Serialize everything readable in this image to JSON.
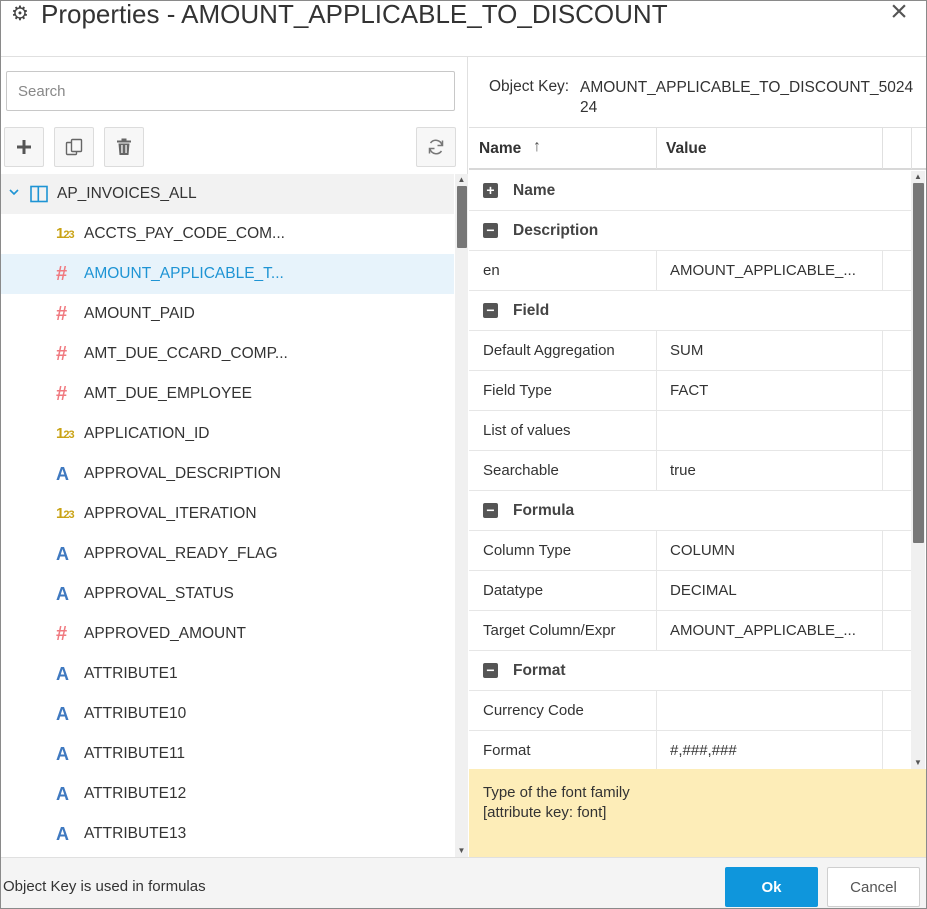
{
  "dialog": {
    "title": "Properties - AMOUNT_APPLICABLE_TO_DISCOUNT",
    "title_icon": "gear-icon",
    "close_label": "×"
  },
  "left": {
    "search_placeholder": "Search",
    "toolbar": {
      "add_icon": "plus-icon",
      "copy_icon": "copy-icon",
      "delete_icon": "trash-icon",
      "refresh_icon": "refresh-icon"
    },
    "root": {
      "label": "AP_INVOICES_ALL",
      "icon": "table-icon"
    },
    "items": [
      {
        "label": "ACCTS_PAY_CODE_COM...",
        "type": "number"
      },
      {
        "label": "AMOUNT_APPLICABLE_T...",
        "type": "decimal",
        "selected": true
      },
      {
        "label": "AMOUNT_PAID",
        "type": "decimal"
      },
      {
        "label": "AMT_DUE_CCARD_COMP...",
        "type": "decimal"
      },
      {
        "label": "AMT_DUE_EMPLOYEE",
        "type": "decimal"
      },
      {
        "label": "APPLICATION_ID",
        "type": "number"
      },
      {
        "label": "APPROVAL_DESCRIPTION",
        "type": "text"
      },
      {
        "label": "APPROVAL_ITERATION",
        "type": "number"
      },
      {
        "label": "APPROVAL_READY_FLAG",
        "type": "text"
      },
      {
        "label": "APPROVAL_STATUS",
        "type": "text"
      },
      {
        "label": "APPROVED_AMOUNT",
        "type": "decimal"
      },
      {
        "label": "ATTRIBUTE1",
        "type": "text"
      },
      {
        "label": "ATTRIBUTE10",
        "type": "text"
      },
      {
        "label": "ATTRIBUTE11",
        "type": "text"
      },
      {
        "label": "ATTRIBUTE12",
        "type": "text"
      },
      {
        "label": "ATTRIBUTE13",
        "type": "text"
      }
    ]
  },
  "right": {
    "object_key_label": "Object Key:",
    "object_key_value": "AMOUNT_APPLICABLE_TO_DISCOUNT_502424",
    "columns": {
      "name": "Name",
      "value": "Value"
    },
    "rows": [
      {
        "kind": "section",
        "label": "Name",
        "toggle": "+"
      },
      {
        "kind": "section",
        "label": "Description",
        "toggle": "−"
      },
      {
        "kind": "prop",
        "name": "en",
        "value": "AMOUNT_APPLICABLE_..."
      },
      {
        "kind": "section",
        "label": "Field",
        "toggle": "−"
      },
      {
        "kind": "prop",
        "name": "Default Aggregation",
        "value": "SUM"
      },
      {
        "kind": "prop",
        "name": "Field Type",
        "value": "FACT"
      },
      {
        "kind": "prop",
        "name": "List of values",
        "value": ""
      },
      {
        "kind": "prop",
        "name": "Searchable",
        "value": "true"
      },
      {
        "kind": "section",
        "label": "Formula",
        "toggle": "−"
      },
      {
        "kind": "prop",
        "name": "Column Type",
        "value": "COLUMN"
      },
      {
        "kind": "prop",
        "name": "Datatype",
        "value": "DECIMAL"
      },
      {
        "kind": "prop",
        "name": "Target Column/Expr",
        "value": "AMOUNT_APPLICABLE_..."
      },
      {
        "kind": "section",
        "label": "Format",
        "toggle": "−"
      },
      {
        "kind": "prop",
        "name": "Currency Code",
        "value": ""
      },
      {
        "kind": "prop",
        "name": "Format",
        "value": "#,###,###"
      }
    ],
    "help_line1": "Type of the font family",
    "help_line2": "[attribute key: font]"
  },
  "footer": {
    "message": "Object Key is used in formulas",
    "ok_label": "Ok",
    "cancel_label": "Cancel"
  },
  "colors": {
    "accent": "#0f96dc",
    "selected_row": "#e7f3fb",
    "help_bg": "#fdedb8",
    "number_icon": "#c9a214",
    "decimal_icon": "#f07a80",
    "text_icon": "#3f79c0"
  }
}
